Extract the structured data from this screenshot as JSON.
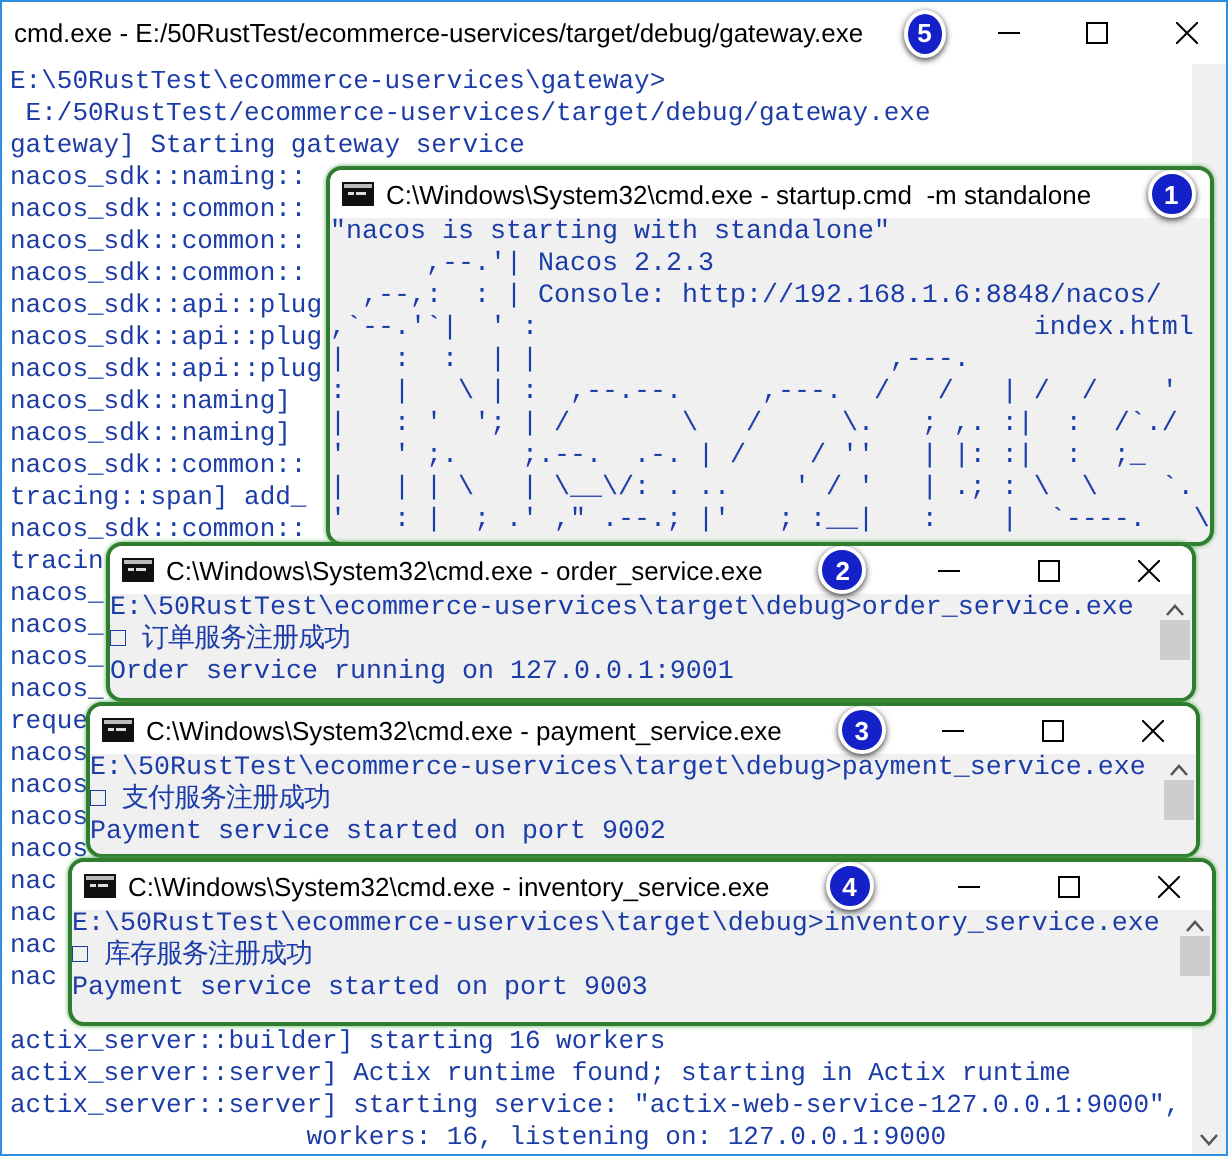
{
  "main_window": {
    "title": "cmd.exe - E:/50RustTest/ecommerce-uservices/target/debug/gateway.exe",
    "badge": "5",
    "lines": [
      "E:\\50RustTest\\ecommerce-uservices\\gateway>",
      " E:/50RustTest/ecommerce-uservices/target/debug/gateway.exe",
      "gateway] Starting gateway service",
      "nacos_sdk::naming::",
      "nacos_sdk::common::",
      "nacos_sdk::common::",
      "nacos_sdk::common::",
      "nacos_sdk::api::plug",
      "nacos_sdk::api::plug",
      "nacos_sdk::api::plug",
      "nacos_sdk::naming]",
      "nacos_sdk::naming]",
      "nacos_sdk::common::",
      "tracing::span] add_",
      "nacos_sdk::common::",
      "tracin",
      "nacos_",
      "nacos_",
      "nacos_",
      "nacos_",
      "reque",
      "nacos",
      "nacos",
      "nacos",
      "nacos",
      "nac",
      "nac",
      "nac",
      "nac"
    ],
    "tail_lines": [
      "actix_server::builder] starting 16 workers",
      "actix_server::server] Actix runtime found; starting in Actix runtime",
      "actix_server::server] starting service: \"actix-web-service-127.0.0.1:9000\",",
      "                   workers: 16, listening on: 127.0.0.1:9000"
    ]
  },
  "windows": [
    {
      "title": "C:\\Windows\\System32\\cmd.exe - startup.cmd  -m standalone",
      "badge": "1",
      "kind": "banner",
      "lines": [
        "\"nacos is starting with standalone\"",
        "      ,--.'| Nacos 2.2.3",
        "  ,--,:  : | Console: http://192.168.1.6:8848/nacos/",
        ",`--.'`|  ' :                               index.html",
        "|   :  :  | |                      ,---.",
        ":   |   \\ | :  ,--.--.     ,---.  /   /   | /  /    '",
        "|   : '  '; | /       \\   /     \\.   ; ,. :|  :  /`./",
        "'   ' ;.    ;.--.  .-. | /    / ''   | |: :|  :  ;_",
        "|   | | \\   | \\__\\/: . ..    ' / '   | .; : \\  \\    `.",
        "'   : |  ; .' ,\" .--.; |'   ; :__|   :    |  `----.   \\"
      ]
    },
    {
      "title": "C:\\Windows\\System32\\cmd.exe - order_service.exe",
      "badge": "2",
      "kind": "service",
      "lines": [
        "E:\\50RustTest\\ecommerce-uservices\\target\\debug>order_service.exe",
        "□ 订单服务注册成功",
        "Order service running on 127.0.0.1:9001"
      ]
    },
    {
      "title": "C:\\Windows\\System32\\cmd.exe - payment_service.exe",
      "badge": "3",
      "kind": "service",
      "lines": [
        "E:\\50RustTest\\ecommerce-uservices\\target\\debug>payment_service.exe",
        "□ 支付服务注册成功",
        "Payment service started on port 9002"
      ]
    },
    {
      "title": "C:\\Windows\\System32\\cmd.exe - inventory_service.exe",
      "badge": "4",
      "kind": "service",
      "lines": [
        "E:\\50RustTest\\ecommerce-uservices\\target\\debug>inventory_service.exe",
        "□ 库存服务注册成功",
        "Payment service started on port 9003"
      ]
    }
  ]
}
